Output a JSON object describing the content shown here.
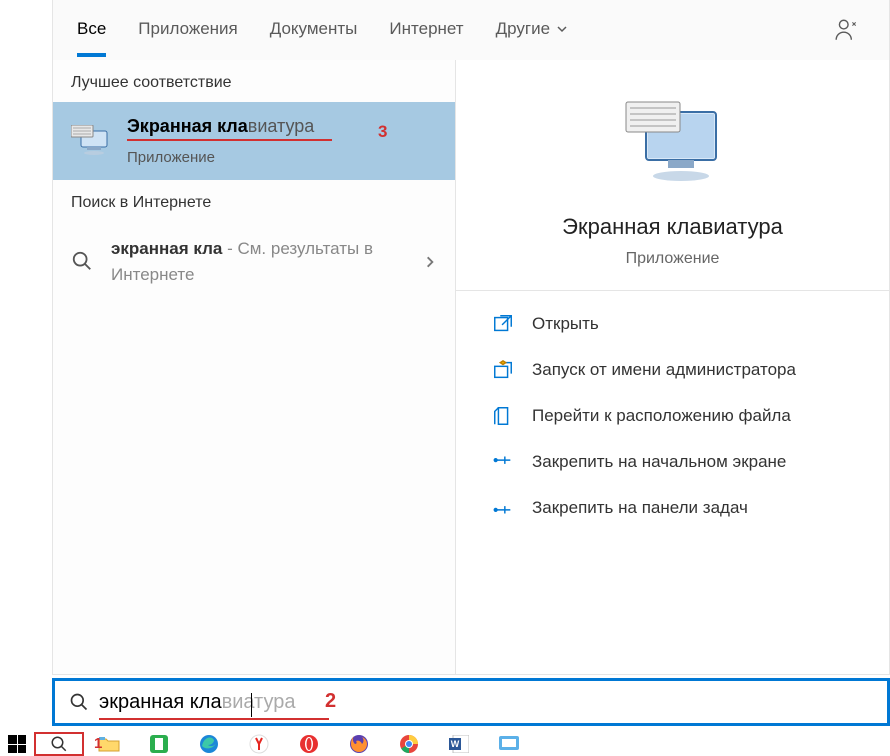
{
  "tabs": {
    "all": "Все",
    "apps": "Приложения",
    "docs": "Документы",
    "web": "Интернет",
    "more": "Другие"
  },
  "sections": {
    "best": "Лучшее соответствие",
    "web": "Поиск в Интернете"
  },
  "bestMatch": {
    "titleBold": "Экранная кла",
    "titleRest": "виатура",
    "sub": "Приложение",
    "annot": "3"
  },
  "webItem": {
    "query": "экранная кла",
    "suffix": " - См. результаты в Интернете"
  },
  "right": {
    "title": "Экранная клавиатура",
    "sub": "Приложение"
  },
  "actions": {
    "open": "Открыть",
    "admin": "Запуск от имени администратора",
    "loc": "Перейти к расположению файла",
    "pinStart": "Закрепить на начальном экране",
    "pinTask": "Закрепить на панели задач"
  },
  "search": {
    "typed": "экранная кла",
    "ghost": "виатура",
    "annot": "2"
  },
  "taskbar": {
    "annot": "1"
  }
}
